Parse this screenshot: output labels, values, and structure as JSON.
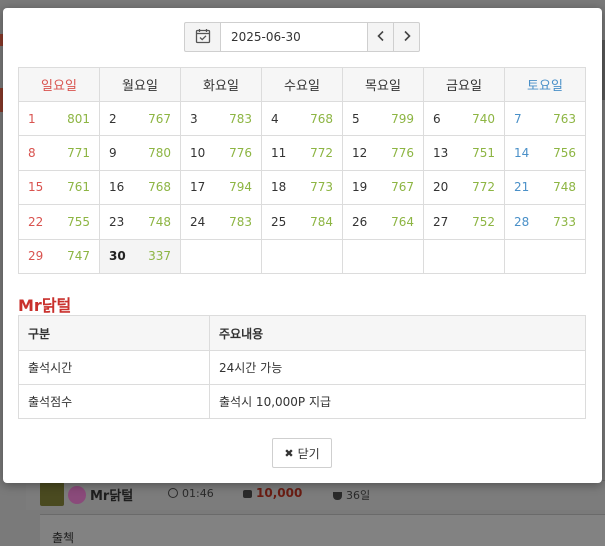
{
  "date_nav": {
    "date_value": "2025-06-30",
    "calendar_icon": "calendar-check-icon",
    "prev_icon": "chevron-left-icon",
    "next_icon": "chevron-right-icon"
  },
  "calendar": {
    "weekdays": [
      "일요일",
      "월요일",
      "화요일",
      "수요일",
      "목요일",
      "금요일",
      "토요일"
    ],
    "weeks": [
      [
        {
          "d": "1",
          "c": "801"
        },
        {
          "d": "2",
          "c": "767"
        },
        {
          "d": "3",
          "c": "783"
        },
        {
          "d": "4",
          "c": "768"
        },
        {
          "d": "5",
          "c": "799"
        },
        {
          "d": "6",
          "c": "740"
        },
        {
          "d": "7",
          "c": "763"
        }
      ],
      [
        {
          "d": "8",
          "c": "771"
        },
        {
          "d": "9",
          "c": "780"
        },
        {
          "d": "10",
          "c": "776"
        },
        {
          "d": "11",
          "c": "772"
        },
        {
          "d": "12",
          "c": "776"
        },
        {
          "d": "13",
          "c": "751"
        },
        {
          "d": "14",
          "c": "756"
        }
      ],
      [
        {
          "d": "15",
          "c": "761"
        },
        {
          "d": "16",
          "c": "768"
        },
        {
          "d": "17",
          "c": "794"
        },
        {
          "d": "18",
          "c": "773"
        },
        {
          "d": "19",
          "c": "767"
        },
        {
          "d": "20",
          "c": "772"
        },
        {
          "d": "21",
          "c": "748"
        }
      ],
      [
        {
          "d": "22",
          "c": "755"
        },
        {
          "d": "23",
          "c": "748"
        },
        {
          "d": "24",
          "c": "783"
        },
        {
          "d": "25",
          "c": "784"
        },
        {
          "d": "26",
          "c": "764"
        },
        {
          "d": "27",
          "c": "752"
        },
        {
          "d": "28",
          "c": "733"
        }
      ],
      [
        {
          "d": "29",
          "c": "747"
        },
        {
          "d": "30",
          "c": "337",
          "today": true
        },
        {
          "d": "",
          "c": ""
        },
        {
          "d": "",
          "c": ""
        },
        {
          "d": "",
          "c": ""
        },
        {
          "d": "",
          "c": ""
        },
        {
          "d": "",
          "c": ""
        }
      ]
    ],
    "colors": {
      "sunday": "#d9534f",
      "saturday": "#4a90c8",
      "count": "#8db543"
    }
  },
  "info": {
    "title": "Mr닭털",
    "headers": [
      "구분",
      "주요내용"
    ],
    "rows": [
      [
        "출석시간",
        "24시간 가능"
      ],
      [
        "출석점수",
        "출석시 10,000P 지급"
      ]
    ]
  },
  "close_button": {
    "label": "닫기",
    "icon": "close-icon"
  },
  "background": {
    "user_name": "Mr닭털",
    "time": "01:46",
    "points": "10,000",
    "days": "36일",
    "checkin_label": "출첵"
  }
}
